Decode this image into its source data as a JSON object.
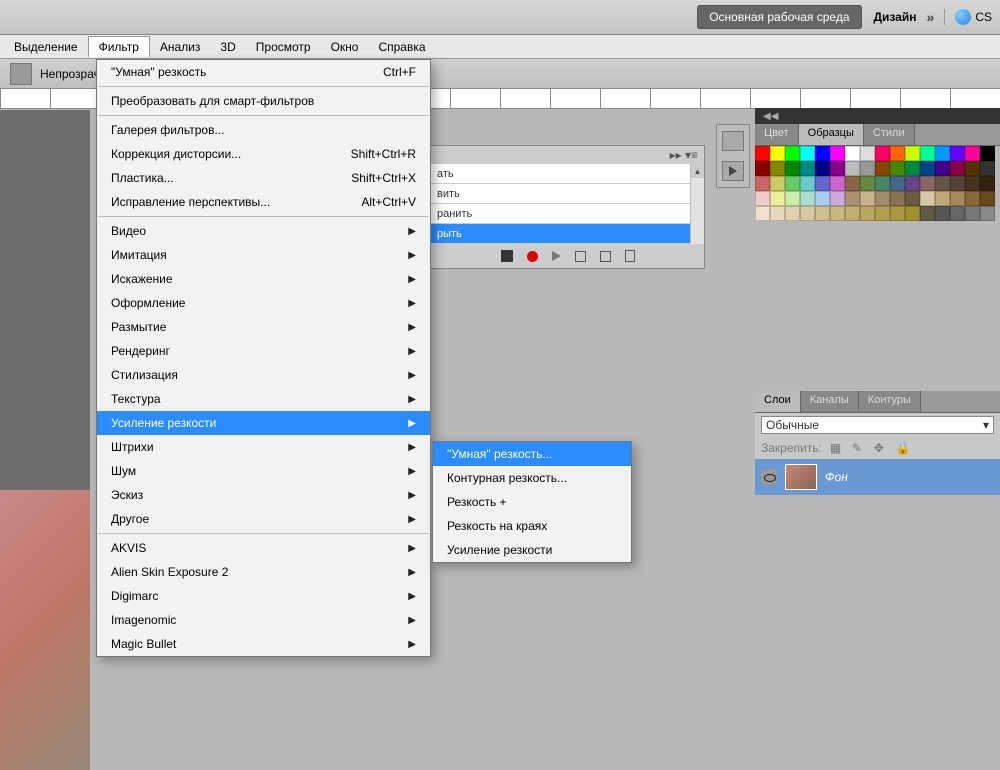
{
  "toolbar": {
    "workspace": "Основная рабочая среда",
    "design": "Дизайн",
    "cs": "CS"
  },
  "menubar": [
    "Выделение",
    "Фильтр",
    "Анализ",
    "3D",
    "Просмотр",
    "Окно",
    "Справка"
  ],
  "options": {
    "opacity_label": "Непрозрач"
  },
  "filter_menu": {
    "last": {
      "label": "\"Умная\" резкость",
      "shortcut": "Ctrl+F"
    },
    "convert": "Преобразовать для смарт-фильтров",
    "g1": [
      {
        "label": "Галерея фильтров..."
      },
      {
        "label": "Коррекция дисторсии...",
        "shortcut": "Shift+Ctrl+R"
      },
      {
        "label": "Пластика...",
        "shortcut": "Shift+Ctrl+X"
      },
      {
        "label": "Исправление перспективы...",
        "shortcut": "Alt+Ctrl+V"
      }
    ],
    "g2": [
      "Видео",
      "Имитация",
      "Искажение",
      "Оформление",
      "Размытие",
      "Рендеринг",
      "Стилизация",
      "Текстура",
      "Усиление резкости",
      "Штрихи",
      "Шум",
      "Эскиз",
      "Другое"
    ],
    "g3": [
      "AKVIS",
      "Alien Skin Exposure 2",
      "Digimarc",
      "Imagenomic",
      "Magic Bullet"
    ],
    "highlighted": "Усиление резкости"
  },
  "sharpen_submenu": {
    "items": [
      "\"Умная\" резкость...",
      "Контурная резкость...",
      "Резкость +",
      "Резкость на краях",
      "Усиление резкости"
    ],
    "highlighted": "\"Умная\" резкость..."
  },
  "actions": {
    "rows": [
      "ать",
      "вить",
      "ранить",
      "рыть"
    ],
    "highlighted": "рыть"
  },
  "color_panel": {
    "tabs": [
      "Цвет",
      "Образцы",
      "Стили"
    ],
    "active": "Образцы"
  },
  "swatch_colors": [
    "#ff0000",
    "#ffff00",
    "#00ff00",
    "#00ffff",
    "#0000ff",
    "#ff00ff",
    "#ffffff",
    "#dddddd",
    "#ff0066",
    "#ff6600",
    "#ccff00",
    "#00ff99",
    "#0099ff",
    "#6600ff",
    "#ff0099",
    "#000000",
    "#880000",
    "#888800",
    "#008800",
    "#008888",
    "#000088",
    "#880088",
    "#bbbbbb",
    "#999999",
    "#884400",
    "#448800",
    "#008844",
    "#004488",
    "#440088",
    "#880044",
    "#553300",
    "#333333",
    "#cc6666",
    "#cccc66",
    "#66cc66",
    "#66cccc",
    "#6666cc",
    "#cc66cc",
    "#886644",
    "#668844",
    "#448866",
    "#446688",
    "#664488",
    "#886666",
    "#665544",
    "#554433",
    "#443322",
    "#332211",
    "#eecccc",
    "#eeee99",
    "#cceeaa",
    "#aaddcc",
    "#aaccee",
    "#ccaadd",
    "#ab9371",
    "#c8b48c",
    "#a38b6a",
    "#8b7252",
    "#6e5a3e",
    "#d8c8a8",
    "#c0a878",
    "#a88858",
    "#886838",
    "#684818",
    "#f0e0d0",
    "#e8d8c0",
    "#e0d0b0",
    "#d8c8a0",
    "#d0c090",
    "#c8b880",
    "#c0b070",
    "#b8a860",
    "#b0a050",
    "#a89840",
    "#a09030",
    "#615846",
    "#555",
    "#666",
    "#777",
    "#888"
  ],
  "layers_panel": {
    "tabs": [
      "Слои",
      "Каналы",
      "Контуры"
    ],
    "active": "Слои",
    "blend_mode": "Обычные",
    "lock_label": "Закрепить:",
    "layer_name": "Фон"
  }
}
